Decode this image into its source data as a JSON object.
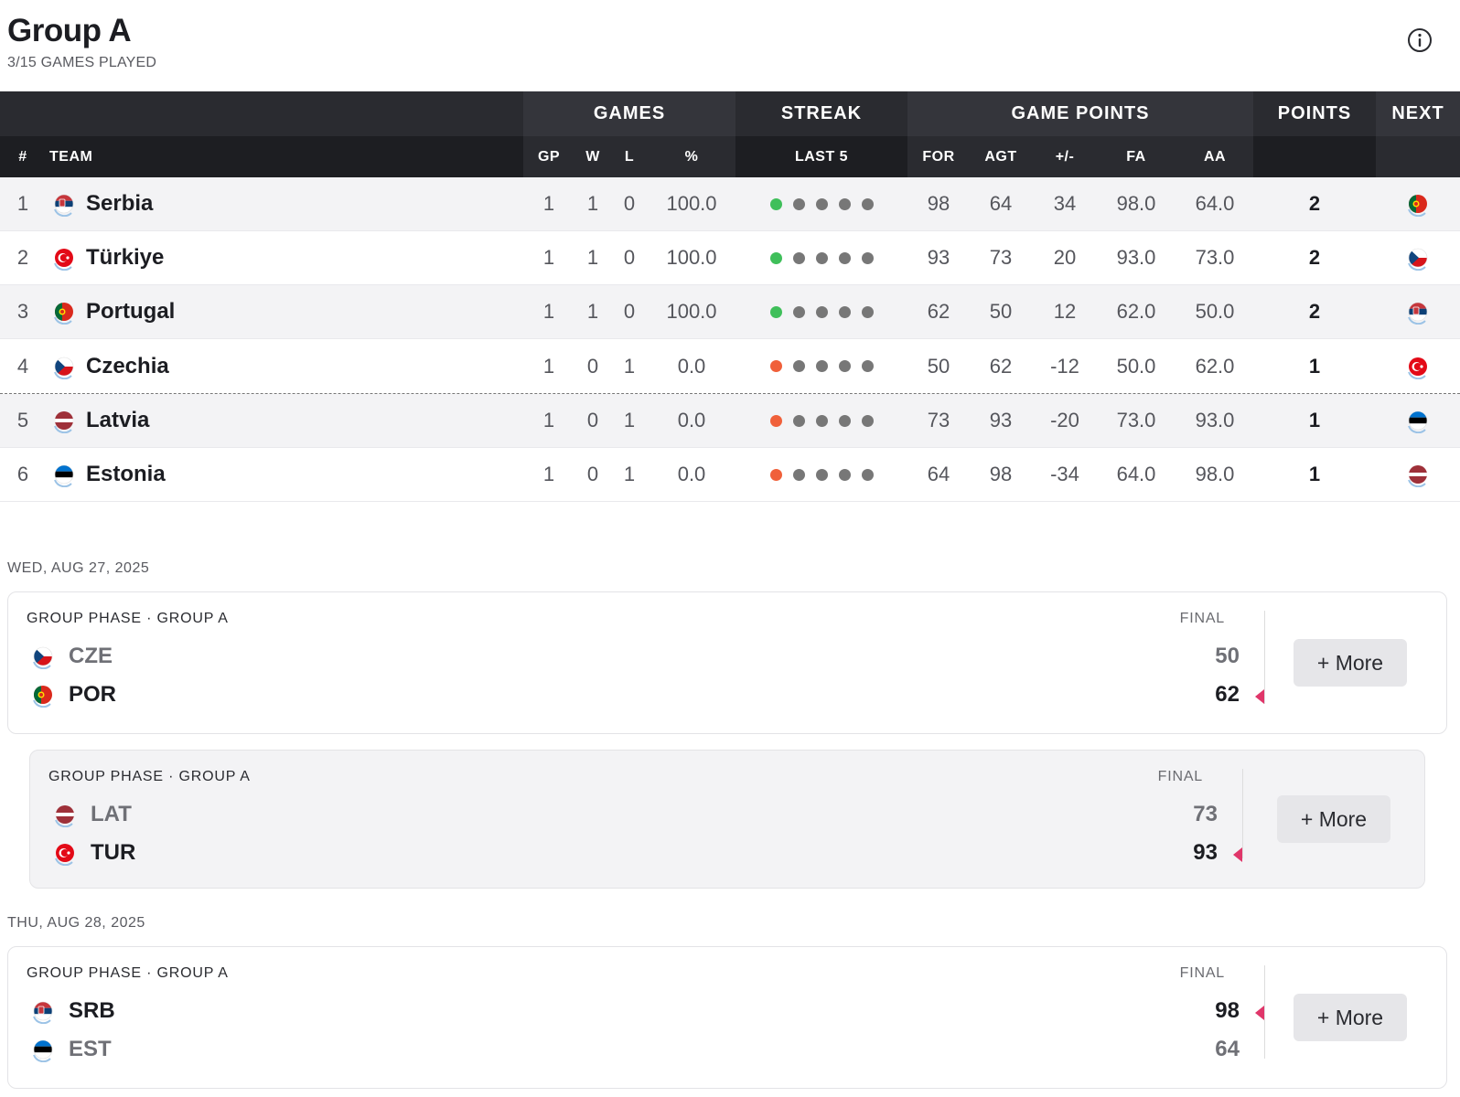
{
  "header": {
    "title": "Group A",
    "subtitle": "3/15 GAMES PLAYED"
  },
  "table": {
    "group_headers": [
      "GAMES",
      "STREAK",
      "GAME POINTS",
      "POINTS",
      "NEXT"
    ],
    "columns": [
      "#",
      "TEAM",
      "GP",
      "W",
      "L",
      "%",
      "LAST 5",
      "FOR",
      "AGT",
      "+/-",
      "FA",
      "AA"
    ],
    "rows": [
      {
        "rank": "1",
        "team": "Serbia",
        "flag": "serbia",
        "gp": "1",
        "w": "1",
        "l": "0",
        "pct": "100.0",
        "last": "win",
        "for": "98",
        "agt": "64",
        "diff": "34",
        "fa": "98.0",
        "aa": "64.0",
        "pts": "2",
        "next": "portugal"
      },
      {
        "rank": "2",
        "team": "Türkiye",
        "flag": "turkiye",
        "gp": "1",
        "w": "1",
        "l": "0",
        "pct": "100.0",
        "last": "win",
        "for": "93",
        "agt": "73",
        "diff": "20",
        "fa": "93.0",
        "aa": "73.0",
        "pts": "2",
        "next": "czechia"
      },
      {
        "rank": "3",
        "team": "Portugal",
        "flag": "portugal",
        "gp": "1",
        "w": "1",
        "l": "0",
        "pct": "100.0",
        "last": "win",
        "for": "62",
        "agt": "50",
        "diff": "12",
        "fa": "62.0",
        "aa": "50.0",
        "pts": "2",
        "next": "serbia"
      },
      {
        "rank": "4",
        "team": "Czechia",
        "flag": "czechia",
        "gp": "1",
        "w": "0",
        "l": "1",
        "pct": "0.0",
        "last": "loss",
        "for": "50",
        "agt": "62",
        "diff": "-12",
        "fa": "50.0",
        "aa": "62.0",
        "pts": "1",
        "next": "turkiye"
      },
      {
        "rank": "5",
        "team": "Latvia",
        "flag": "latvia",
        "gp": "1",
        "w": "0",
        "l": "1",
        "pct": "0.0",
        "last": "loss",
        "for": "73",
        "agt": "93",
        "diff": "-20",
        "fa": "73.0",
        "aa": "93.0",
        "pts": "1",
        "next": "estonia"
      },
      {
        "rank": "6",
        "team": "Estonia",
        "flag": "estonia",
        "gp": "1",
        "w": "0",
        "l": "1",
        "pct": "0.0",
        "last": "loss",
        "for": "64",
        "agt": "98",
        "diff": "-34",
        "fa": "64.0",
        "aa": "98.0",
        "pts": "1",
        "next": "latvia"
      }
    ]
  },
  "colors": {
    "win": "#3fbf5a",
    "loss": "#f0603a",
    "neutral": "#777777",
    "arrow": "#e0366a"
  },
  "games": {
    "dates": [
      "WED, AUG 27, 2025",
      "THU, AUG 28, 2025"
    ],
    "matches": [
      {
        "phase": "GROUP PHASE · GROUP A",
        "status": "FINAL",
        "more": "+ More",
        "home": {
          "code": "CZE",
          "flag": "czechia",
          "score": "50",
          "winner": false
        },
        "away": {
          "code": "POR",
          "flag": "portugal",
          "score": "62",
          "winner": true
        }
      },
      {
        "phase": "GROUP PHASE · GROUP A",
        "status": "FINAL",
        "more": "+ More",
        "home": {
          "code": "LAT",
          "flag": "latvia",
          "score": "73",
          "winner": false
        },
        "away": {
          "code": "TUR",
          "flag": "turkiye",
          "score": "93",
          "winner": true
        }
      },
      {
        "phase": "GROUP PHASE · GROUP A",
        "status": "FINAL",
        "more": "+ More",
        "home": {
          "code": "SRB",
          "flag": "serbia",
          "score": "98",
          "winner": true
        },
        "away": {
          "code": "EST",
          "flag": "estonia",
          "score": "64",
          "winner": false
        }
      }
    ]
  }
}
